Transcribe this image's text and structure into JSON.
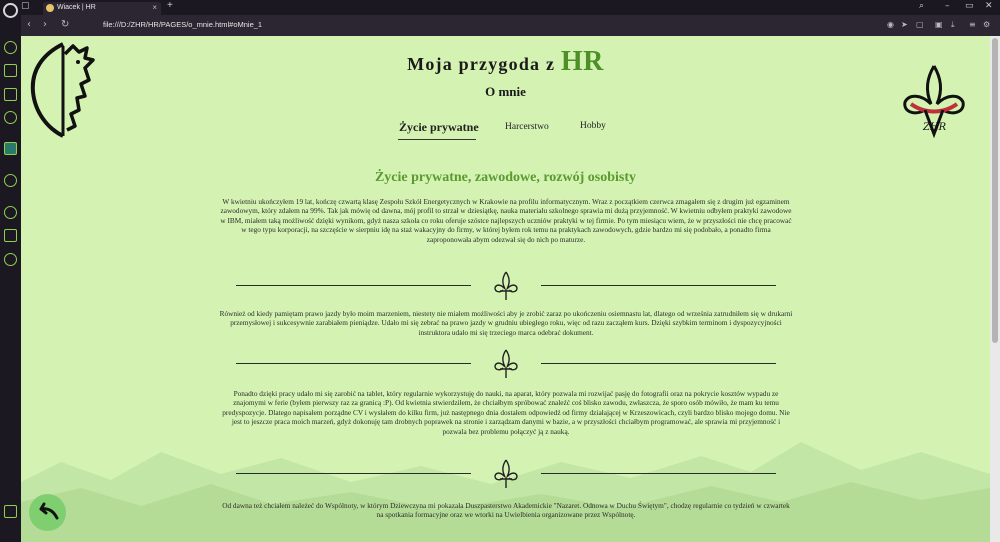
{
  "browser": {
    "tab_title": "Wiacek | HR",
    "close_tab": "×",
    "new_tab": "+",
    "url": "file:///D:/ZHR/HR/PAGES/o_mnie.html#oMnie_1"
  },
  "header": {
    "title_prefix": "Moja przygoda z",
    "title_accent": "HR",
    "subtitle": "O mnie"
  },
  "nav": {
    "tabs": [
      {
        "label": "Życie prywatne",
        "active": true
      },
      {
        "label": "Harcerstwo",
        "active": false
      },
      {
        "label": "Hobby",
        "active": false
      }
    ]
  },
  "content": {
    "section_title": "Życie prywatne, zawodowe, rozwój osobisty",
    "paragraphs": [
      "W kwietniu ukończyłem 19 lat, kończę czwartą klasę Zespołu Szkół Energetycznych w Krakowie na profilu informatycznym. Wraz z początkiem czerwca zmagałem się z drugim już egzaminem zawodowym, który zdałem na 99%. Tak jak mówię od dawna, mój profil to strzał w dziesiątkę, nauka materiału szkolnego sprawia mi dużą przyjemność. W kwietniu odbyłem praktyki zawodowe w IBM, miałem taką możliwość dzięki wynikom, gdyż nasza szkoła co roku oferuje szóstce najlepszych uczniów praktyki w tej firmie. Po tym miesiącu wiem, że w przyszłości nie chcę pracować w tego typu korporacji, na szczęście w sierpniu idę na staż wakacyjny do firmy, w której byłem rok temu na praktykach zawodowych, gdzie bardzo mi się podobało, a ponadto firma zaproponowała abym odezwał się do nich po maturze.",
      "Również od kiedy pamiętam prawo jazdy było moim marzeniem, niestety nie miałem możliwości aby je zrobić zaraz po ukończeniu osiemnastu lat, dlatego od września zatrudniłem się w drukarni przemysłowej i sukcesywnie zarabiałem pieniądze. Udało mi się zebrać na prawo jazdy w grudniu ubiegłego roku, więc od razu zacząłem kurs. Dzięki szybkim terminom i dyspozycyjności instruktora udało mi się trzeciego marca odebrać dokument.",
      "Ponadto dzięki pracy udało mi się zarobić na tablet, który regularnie wykorzystuję do nauki, na aparat, który pozwala mi rozwijać pasję do fotografii oraz na pokrycie kosztów wypadu ze znajomymi w ferie (byłem pierwszy raz za granicą :P). Od kwietnia stwierdziłem, że chciałbym spróbować znaleźć coś blisko zawodu, zwłaszcza, że sporo osób mówiło, że mam ku temu predyspozycje. Dlatego napisałem porządne CV i wysłałem do kilku firm, już następnego dnia dostałem odpowiedź od firmy działającej w Krzeszowicach, czyli bardzo blisko mojego domu. Nie jest to jeszcze praca moich marzeń, gdyż dokonuję tam drobnych poprawek na stronie i zarządzam danymi w bazie, a w przyszłości chciałbym programować, ale sprawia mi przyjemność i pozwala bez problemu połączyć ją z nauką.",
      "Od dawna też chciałem należeć do Wspólnoty, w którym Dziewczyna mi pokazała Duszpasterstwo Akademickie \"Nazaret. Odnowa w Duchu Świętym\", chodzę regularnie co tydzień w czwartek na spotkania formacyjne oraz we wtorki na Uwielbienia organizowane przez Wspólnotę."
    ]
  },
  "colors": {
    "page_bg": "#d4f3b3",
    "accent": "#4e8f27",
    "section_title": "#5a9a2e",
    "back_button": "#7fce6f"
  },
  "icons": {
    "back": "back-arrow-icon",
    "divider": "fleur-de-lis-icon",
    "logo_left": "dragon-emblem",
    "logo_right": "zhr-lily-emblem"
  }
}
